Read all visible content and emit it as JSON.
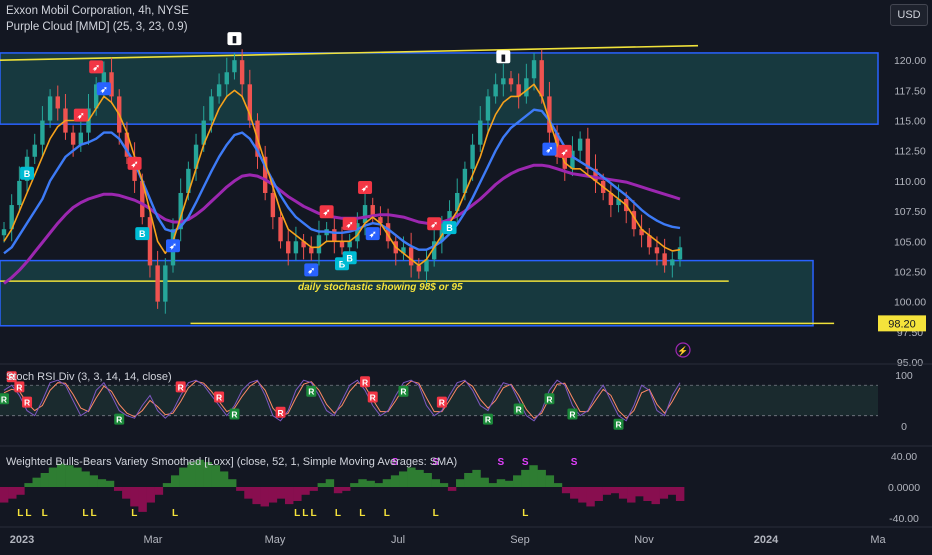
{
  "header": {
    "title": "Exxon Mobil Corporation, 4h, NYSE",
    "indicator1": "Purple Cloud [MMD] (25, 3, 23, 0.9)",
    "currency": "USD"
  },
  "colors": {
    "background": "#131722",
    "zone_fill": "#17393f",
    "zone_line": "#2962ff",
    "support_line": "#f0e23a",
    "up_candle": "#26a69a",
    "down_candle": "#ef5350",
    "ema_fast": "#f7a21b",
    "ema_mid": "#3d7bf7",
    "ema_slow": "#9c27b0",
    "stoch_k": "#7e57c2",
    "stoch_d": "#ff8a65",
    "bull": "#2e7d32",
    "bear": "#880e4f",
    "price_tag": "#f5e33b"
  },
  "chart_data": [
    {
      "type": "line",
      "name": "price",
      "title": "Exxon Mobil Corporation, 4h, NYSE",
      "x_ticks": [
        "2023",
        "Mar",
        "May",
        "Jul",
        "Sep",
        "Nov",
        "2024",
        "Ma"
      ],
      "y_ticks": [
        "120.00",
        "117.50",
        "115.00",
        "112.50",
        "110.00",
        "107.50",
        "105.00",
        "102.50",
        "100.00",
        "97.50",
        "95.00"
      ],
      "ylim": [
        95,
        122.5
      ],
      "price_tag": "98.20",
      "annotation": "daily stochastic showing 98$ or 95",
      "close": [
        106,
        108,
        110,
        112,
        113,
        115,
        117,
        116,
        114,
        113,
        114,
        116,
        118,
        119,
        117,
        114,
        112,
        110,
        107,
        103,
        100,
        103,
        106,
        109,
        111,
        113,
        115,
        117,
        118,
        119,
        120,
        118,
        115,
        112,
        109,
        107,
        105,
        104,
        105,
        104.5,
        104,
        105.5,
        106,
        105,
        104.5,
        105,
        106.5,
        108,
        107,
        106.5,
        105,
        104,
        104.5,
        103,
        102.5,
        103.5,
        105,
        106.5,
        107.5,
        109,
        111,
        113,
        115,
        117,
        118,
        118.5,
        118,
        117,
        118.5,
        120,
        117,
        114,
        112,
        111,
        112.5,
        113.5,
        111,
        110,
        109,
        108,
        108.5,
        107.5,
        106,
        105.5,
        104.5,
        104,
        103,
        103.5,
        104.5
      ],
      "ema_fast": [
        105,
        106,
        107.5,
        109,
        110.5,
        112,
        113.5,
        114.5,
        115,
        115,
        115,
        115,
        116,
        117,
        116.5,
        115.5,
        114,
        112,
        110,
        107.5,
        105,
        104,
        105,
        107,
        109,
        111,
        113,
        114.5,
        116,
        117,
        117.5,
        117,
        115.5,
        113.5,
        111.5,
        109.5,
        107.5,
        106,
        105.5,
        105,
        104.5,
        104.5,
        105,
        105,
        105,
        105,
        105.5,
        106.5,
        107,
        106.5,
        105.5,
        104.5,
        104,
        103.5,
        103,
        103.5,
        104.5,
        105.5,
        106.5,
        107.5,
        109,
        110.5,
        112,
        114,
        115.5,
        116.5,
        117,
        117,
        117.5,
        118,
        117,
        115,
        113,
        111.5,
        111,
        111,
        110.5,
        110,
        109.5,
        109,
        108.5,
        108,
        107,
        106,
        105.5,
        105,
        104.5,
        104.2,
        104.3
      ],
      "ema_mid": [
        104,
        104.5,
        105.5,
        106.5,
        107.5,
        108.5,
        110,
        111,
        112,
        112.5,
        113,
        113.2,
        113.5,
        114,
        114,
        113.5,
        112.5,
        111.5,
        110,
        108.5,
        107,
        106,
        105.8,
        106.2,
        107,
        108.2,
        109.5,
        110.8,
        112,
        113,
        113.8,
        114,
        113.5,
        112.5,
        111.2,
        110,
        108.8,
        107.8,
        107,
        106.5,
        106,
        105.8,
        105.8,
        105.7,
        105.7,
        105.8,
        106,
        106.3,
        106.5,
        106.4,
        106,
        105.5,
        105,
        104.6,
        104.3,
        104.3,
        104.6,
        105,
        105.6,
        106.4,
        107.4,
        108.6,
        109.9,
        111.2,
        112.5,
        113.6,
        114.4,
        114.9,
        115.4,
        115.9,
        115.8,
        115,
        113.9,
        112.8,
        112,
        111.6,
        111.2,
        110.8,
        110.3,
        109.8,
        109.3,
        108.8,
        108.2,
        107.6,
        107.1,
        106.7,
        106.4,
        106.2,
        106.1
      ],
      "ema_slow": [
        101.5,
        102,
        102.6,
        103.3,
        104.1,
        104.9,
        105.7,
        106.5,
        107.2,
        107.8,
        108.2,
        108.5,
        108.7,
        108.9,
        108.9,
        108.8,
        108.6,
        108.4,
        108.1,
        107.7,
        107.2,
        106.8,
        106.6,
        106.6,
        106.8,
        107.2,
        107.7,
        108.3,
        108.9,
        109.5,
        110,
        110.4,
        110.5,
        110.4,
        110.1,
        109.7,
        109.2,
        108.7,
        108.3,
        107.9,
        107.6,
        107.3,
        107.1,
        107,
        106.9,
        106.9,
        106.9,
        107,
        107.1,
        107.2,
        107.2,
        107.1,
        107,
        106.8,
        106.6,
        106.5,
        106.5,
        106.6,
        106.8,
        107.1,
        107.5,
        108,
        108.5,
        109.1,
        109.7,
        110.2,
        110.6,
        110.9,
        111.1,
        111.3,
        111.3,
        111.2,
        111,
        110.8,
        110.6,
        110.5,
        110.4,
        110.3,
        110.2,
        110.1,
        110,
        109.9,
        109.7,
        109.5,
        109.3,
        109.1,
        108.9,
        108.7,
        108.5
      ],
      "zones": [
        {
          "top": 120.6,
          "bottom": 114.7,
          "x_start": 0,
          "x_end": 1
        },
        {
          "top": 103.4,
          "bottom": 98.0,
          "x_start": 0,
          "x_end": 0.926
        }
      ],
      "lines": [
        {
          "y_start": 120.0,
          "y_end": 121.2,
          "x_start": 0,
          "x_end": 0.795
        },
        {
          "y_start": 101.7,
          "y_end": 101.7,
          "x_start": 0,
          "x_end": 0.83
        },
        {
          "y_start": 98.2,
          "y_end": 98.2,
          "x_start": 0.217,
          "x_end": 0.95
        }
      ],
      "signals": [
        {
          "i": 3,
          "text": "B",
          "kind": "buy"
        },
        {
          "i": 10,
          "text": "rocket",
          "kind": "sell"
        },
        {
          "i": 12,
          "text": "rocket",
          "kind": "sell"
        },
        {
          "i": 13,
          "text": "rocket",
          "kind": "buy"
        },
        {
          "i": 17,
          "text": "rocket",
          "kind": "sell"
        },
        {
          "i": 18,
          "text": "B",
          "kind": "buy"
        },
        {
          "i": 22,
          "text": "rocket",
          "kind": "buy"
        },
        {
          "i": 30,
          "text": "flag",
          "kind": "white"
        },
        {
          "i": 40,
          "text": "rocket",
          "kind": "buy"
        },
        {
          "i": 42,
          "text": "rocket",
          "kind": "sell"
        },
        {
          "i": 45,
          "text": "rocket",
          "kind": "sell"
        },
        {
          "i": 47,
          "text": "rocket",
          "kind": "sell"
        },
        {
          "i": 44,
          "text": "B",
          "kind": "buy"
        },
        {
          "i": 45,
          "text": "B",
          "kind": "buy"
        },
        {
          "i": 48,
          "text": "rocket",
          "kind": "buy"
        },
        {
          "i": 56,
          "text": "rocket",
          "kind": "sell"
        },
        {
          "i": 58,
          "text": "B",
          "kind": "buy"
        },
        {
          "i": 65,
          "text": "flag",
          "kind": "white"
        },
        {
          "i": 71,
          "text": "rocket",
          "kind": "buy"
        },
        {
          "i": 73,
          "text": "rocket",
          "kind": "sell"
        }
      ]
    },
    {
      "type": "line",
      "name": "stoch-rsi",
      "title": "Stoch RSI Div (3, 3, 14, 14, close)",
      "y_ticks": [
        "100",
        "0"
      ],
      "ylim": [
        -20,
        110
      ],
      "k": [
        70,
        80,
        60,
        30,
        20,
        50,
        85,
        90,
        80,
        50,
        20,
        30,
        70,
        85,
        60,
        30,
        20,
        15,
        40,
        60,
        30,
        15,
        30,
        60,
        85,
        90,
        80,
        60,
        40,
        20,
        40,
        70,
        85,
        90,
        60,
        20,
        10,
        30,
        70,
        90,
        85,
        60,
        30,
        20,
        50,
        80,
        90,
        70,
        40,
        20,
        30,
        60,
        85,
        90,
        80,
        40,
        20,
        30,
        60,
        85,
        90,
        70,
        40,
        30,
        60,
        85,
        80,
        50,
        20,
        10,
        30,
        70,
        90,
        80,
        40,
        20,
        30,
        60,
        80,
        50,
        20,
        10,
        40,
        80,
        70,
        30,
        20,
        60,
        85
      ],
      "d": [
        65,
        72,
        68,
        45,
        30,
        40,
        70,
        85,
        84,
        62,
        35,
        28,
        55,
        78,
        68,
        42,
        25,
        18,
        30,
        50,
        38,
        22,
        25,
        48,
        75,
        88,
        84,
        68,
        48,
        28,
        35,
        58,
        78,
        88,
        70,
        35,
        18,
        25,
        55,
        82,
        87,
        70,
        42,
        25,
        40,
        68,
        85,
        78,
        52,
        28,
        28,
        50,
        75,
        88,
        84,
        55,
        28,
        28,
        50,
        75,
        88,
        78,
        52,
        35,
        50,
        75,
        82,
        60,
        32,
        15,
        25,
        55,
        82,
        84,
        55,
        28,
        28,
        50,
        72,
        60,
        30,
        15,
        30,
        65,
        72,
        42,
        25,
        48,
        75
      ],
      "markers": [
        {
          "i": 1,
          "text": "R",
          "kind": "bear"
        },
        {
          "i": 2,
          "text": "R",
          "kind": "bear"
        },
        {
          "i": 3,
          "text": "R",
          "kind": "bear"
        },
        {
          "i": 0,
          "text": "R",
          "kind": "bull"
        },
        {
          "i": 15,
          "text": "R",
          "kind": "bull"
        },
        {
          "i": 23,
          "text": "R",
          "kind": "bear"
        },
        {
          "i": 28,
          "text": "R",
          "kind": "bear"
        },
        {
          "i": 30,
          "text": "R",
          "kind": "bull"
        },
        {
          "i": 36,
          "text": "R",
          "kind": "bear"
        },
        {
          "i": 40,
          "text": "R",
          "kind": "bull"
        },
        {
          "i": 47,
          "text": "R",
          "kind": "bear"
        },
        {
          "i": 48,
          "text": "R",
          "kind": "bear"
        },
        {
          "i": 52,
          "text": "R",
          "kind": "bull"
        },
        {
          "i": 57,
          "text": "R",
          "kind": "bear"
        },
        {
          "i": 63,
          "text": "R",
          "kind": "bull"
        },
        {
          "i": 67,
          "text": "R",
          "kind": "bull"
        },
        {
          "i": 71,
          "text": "R",
          "kind": "bull"
        },
        {
          "i": 74,
          "text": "R",
          "kind": "bull"
        },
        {
          "i": 80,
          "text": "R",
          "kind": "bull"
        }
      ]
    },
    {
      "type": "bar",
      "name": "bulls-bears",
      "title": "Weighted Bulls-Bears Variety Smoothed [Loxx] (close, 52, 1, Simple Moving Averages: SMA)",
      "y_ticks": [
        "40.00",
        "0.0000",
        "-40.00"
      ],
      "ylim": [
        -45,
        45
      ],
      "values": [
        -20,
        -15,
        -10,
        5,
        12,
        18,
        25,
        30,
        28,
        25,
        20,
        15,
        10,
        8,
        -5,
        -15,
        -25,
        -32,
        -20,
        -10,
        5,
        15,
        25,
        32,
        35,
        32,
        28,
        20,
        10,
        -5,
        -15,
        -22,
        -25,
        -20,
        -15,
        -22,
        -18,
        -10,
        -5,
        5,
        10,
        -8,
        -5,
        5,
        10,
        8,
        5,
        10,
        15,
        20,
        25,
        22,
        18,
        10,
        5,
        -5,
        10,
        18,
        22,
        12,
        5,
        10,
        8,
        15,
        22,
        28,
        22,
        15,
        5,
        -8,
        -15,
        -20,
        -25,
        -18,
        -10,
        -8,
        -15,
        -20,
        -12,
        -18,
        -22,
        -15,
        -10,
        -18
      ],
      "markers": [
        {
          "i": 2,
          "text": "L",
          "kind": "yellow"
        },
        {
          "i": 3,
          "text": "L",
          "kind": "yellow"
        },
        {
          "i": 5,
          "text": "L",
          "kind": "yellow"
        },
        {
          "i": 10,
          "text": "L",
          "kind": "yellow"
        },
        {
          "i": 11,
          "text": "L",
          "kind": "yellow"
        },
        {
          "i": 16,
          "text": "L",
          "kind": "yellow"
        },
        {
          "i": 21,
          "text": "L",
          "kind": "yellow"
        },
        {
          "i": 36,
          "text": "L",
          "kind": "yellow"
        },
        {
          "i": 37,
          "text": "L",
          "kind": "yellow"
        },
        {
          "i": 38,
          "text": "L",
          "kind": "yellow"
        },
        {
          "i": 41,
          "text": "L",
          "kind": "yellow"
        },
        {
          "i": 44,
          "text": "L",
          "kind": "yellow"
        },
        {
          "i": 47,
          "text": "L",
          "kind": "yellow"
        },
        {
          "i": 53,
          "text": "L",
          "kind": "yellow"
        },
        {
          "i": 64,
          "text": "L",
          "kind": "yellow"
        },
        {
          "i": 48,
          "text": "S",
          "kind": "pink"
        },
        {
          "i": 53,
          "text": "S",
          "kind": "pink"
        },
        {
          "i": 61,
          "text": "S",
          "kind": "pink"
        },
        {
          "i": 64,
          "text": "S",
          "kind": "pink"
        },
        {
          "i": 70,
          "text": "S",
          "kind": "pink"
        }
      ]
    }
  ]
}
